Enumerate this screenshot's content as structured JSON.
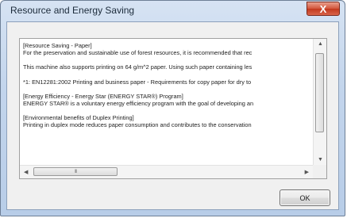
{
  "window": {
    "title": "Resource and Energy Saving",
    "close_symbol": "X"
  },
  "content": {
    "paragraphs": [
      [
        "[Resource Saving - Paper]",
        "For the preservation and sustainable use of forest resources, it is recommended that rec"
      ],
      [
        "This machine also supports printing on 64 g/m^2 paper.  Using such paper containing les"
      ],
      [
        "*1: EN12281:2002 Printing and business paper - Requirements for copy paper for dry to"
      ],
      [
        "[Energy Efficiency - Energy Star (ENERGY STAR®) Program]",
        "ENERGY STAR® is a voluntary energy efficiency program with the goal of developing an"
      ],
      [
        "[Environmental benefits of Duplex Printing]",
        "Printing in duplex mode reduces paper consumption and contributes to the conservation"
      ]
    ]
  },
  "scroll": {
    "vertical_position": 0,
    "horizontal_position": 0,
    "h_thumb_grip": "III"
  },
  "buttons": {
    "ok_label": "OK"
  }
}
